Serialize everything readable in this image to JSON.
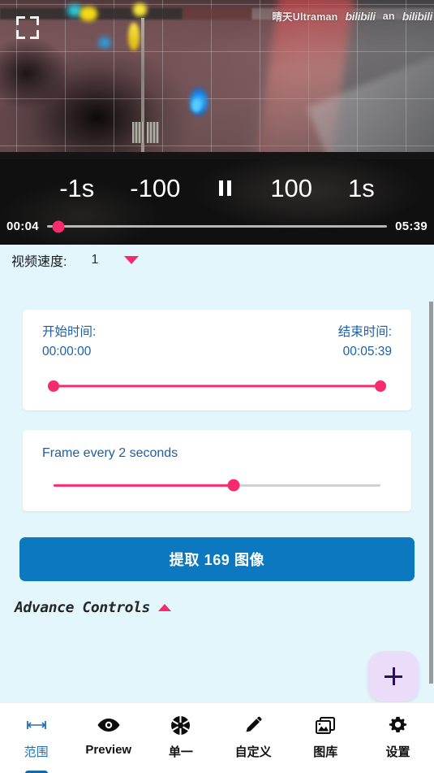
{
  "video": {
    "fullscreen_icon": "fullscreen-expand-icon",
    "watermark_left": "晴天Ultraman",
    "watermark_brand": "bilibili",
    "watermark_right": "an",
    "watermark_brand2": "bilibili"
  },
  "player": {
    "back_1s_label": "-1s",
    "back_100_label": "-100",
    "pause_icon": "pause-icon",
    "forward_100_label": "100",
    "forward_1s_label": "1s",
    "current_time": "00:04",
    "total_time": "05:39",
    "progress_percent": 3.3
  },
  "speed": {
    "label": "视频速度:",
    "value": "1",
    "caret_icon": "chevron-down-icon"
  },
  "range_card": {
    "start_title": "开始时间:",
    "start_value": "00:00:00",
    "end_title": "结束时间:",
    "end_value": "00:05:39",
    "slider_start_percent": 0,
    "slider_end_percent": 100
  },
  "frame_card": {
    "label": "Frame every 2 seconds",
    "slider_percent": 55
  },
  "extract": {
    "label": "提取 169 图像",
    "count": "169",
    "color": "#0b78bf"
  },
  "advance": {
    "label": "Advance Controls",
    "caret_icon": "chevron-up-icon",
    "expanded": true
  },
  "fab": {
    "icon": "plus-icon",
    "background": "#ebddfa",
    "icon_color": "#2d0f57"
  },
  "bottom_nav": {
    "items": [
      {
        "label": "范围",
        "icon": "range-arrows-icon",
        "active": true
      },
      {
        "label": "Preview",
        "icon": "eye-icon",
        "active": false
      },
      {
        "label": "单一",
        "icon": "aperture-icon",
        "active": false
      },
      {
        "label": "自定义",
        "icon": "pencil-icon",
        "active": false
      },
      {
        "label": "图库",
        "icon": "photo-stack-icon",
        "active": false
      },
      {
        "label": "设置",
        "icon": "gear-icon",
        "active": false
      }
    ]
  },
  "theme": {
    "background": "#e2f6fc",
    "accent_pink": "#f72a6d",
    "accent_blue": "#0b78bf",
    "text_blue": "#1d5fa8"
  }
}
